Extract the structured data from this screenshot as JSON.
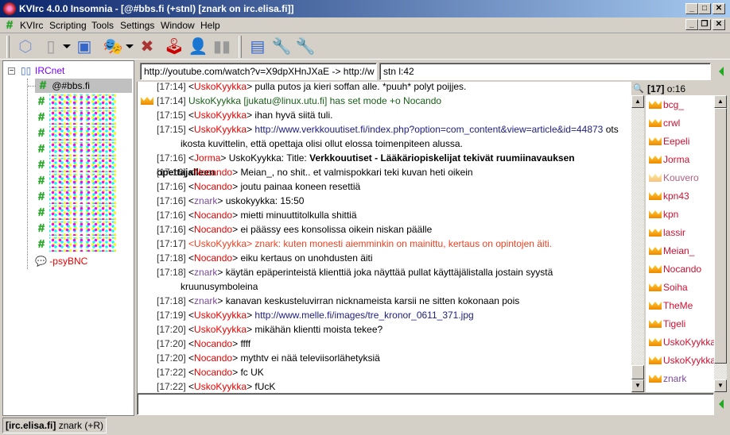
{
  "window": {
    "title": "KVIrc 4.0.0 Insomnia - [@#bbs.fi (+stnl) [znark on irc.elisa.fi]]",
    "min": "_",
    "max": "□",
    "restore": "❐",
    "close": "✕"
  },
  "menu": [
    "KVIrc",
    "Scripting",
    "Tools",
    "Settings",
    "Window",
    "Help"
  ],
  "tree": {
    "network": "IRCnet",
    "active_channel": "@#bbs.fi",
    "query": "-psyBNC"
  },
  "topic": "http://youtube.com/watch?v=X9dpXHnJXaE -> http://w",
  "modes": "stn l:42",
  "messages": [
    {
      "time": "[17:14]",
      "nick": "UskoKyykka",
      "text": "pulla putos ja kieri soffan alle. *puuh* polyt poijjes.",
      "type": "msg"
    },
    {
      "time": "[17:14]",
      "nick": "",
      "text": "UskoKyykka [jukatu@linux.utu.fi] has set mode +o Nocando",
      "type": "mode"
    },
    {
      "time": "[17:15]",
      "nick": "UskoKyykka",
      "text": "ihan hyvä siitä tuli.",
      "type": "msg"
    },
    {
      "time": "[17:15]",
      "nick": "UskoKyykka",
      "text": "http://www.verkkouutiset.fi/index.php?option=com_content&view=article&id=44873",
      "text2": " ots",
      "cont": "ikosta kuvittelin, että opettaja olisi ollut elossa toimenpiteen alussa.",
      "type": "url"
    },
    {
      "time": "[17:16]",
      "nick": "Jorma",
      "text": "UskoKyykka: Title: ",
      "bold": "Verkkouutiset - Lääkäriopiskelijat tekivät ruumiinavauksen opettajalleen",
      "type": "title"
    },
    {
      "time": "[17:16]",
      "nick": "Nocando",
      "text": "Meian_, no shit.. et valmispokkari teki kuvan heti oikein",
      "type": "msg"
    },
    {
      "time": "[17:16]",
      "nick": "Nocando",
      "text": "joutu painaa koneen resettiä",
      "type": "msg"
    },
    {
      "time": "[17:16]",
      "nick": "znark",
      "text": "uskokyykka: 15:50",
      "type": "self"
    },
    {
      "time": "[17:16]",
      "nick": "Nocando",
      "text": "mietti minuuttitolkulla shittiä",
      "type": "msg"
    },
    {
      "time": "[17:16]",
      "nick": "Nocando",
      "text": "ei päässy ees konsolissa oikein niskan päälle",
      "type": "msg"
    },
    {
      "time": "[17:17]",
      "nick": "UskoKyykka",
      "text": "znark: kuten monesti aiemminkin on mainittu, kertaus on opintojen äiti.",
      "type": "highlight"
    },
    {
      "time": "[17:18]",
      "nick": "Nocando",
      "text": "eiku kertaus on unohdusten äiti",
      "type": "msg"
    },
    {
      "time": "[17:18]",
      "nick": "znark",
      "text": "käytän epäperinteistä klienttiä joka näyttää pullat käyttäjälistalla jostain syystä",
      "cont": "kruunusymboleina",
      "type": "self"
    },
    {
      "time": "[17:18]",
      "nick": "znark",
      "text": "kanavan keskusteluvirran nicknameista karsii ne sitten kokonaan pois",
      "type": "self"
    },
    {
      "time": "[17:19]",
      "nick": "UskoKyykka",
      "text": "http://www.melle.fi/images/tre_kronor_0611_371.jpg",
      "type": "url"
    },
    {
      "time": "[17:20]",
      "nick": "UskoKyykka",
      "text": "mikähän klientti moista tekee?",
      "type": "msg"
    },
    {
      "time": "[17:20]",
      "nick": "Nocando",
      "text": "ffff",
      "type": "msg"
    },
    {
      "time": "[17:20]",
      "nick": "Nocando",
      "text": "mythtv ei nää televiisorlähetyksiä",
      "type": "msg"
    },
    {
      "time": "[17:22]",
      "nick": "Nocando",
      "text": "fc UK",
      "type": "msg"
    },
    {
      "time": "[17:22]",
      "nick": "UskoKyykka",
      "text": "fUcK",
      "type": "msg"
    }
  ],
  "userlist": {
    "count": "[17]",
    "ops": "o:16",
    "users": [
      "bcg_",
      "crwl",
      "Eepeli",
      "Jorma",
      "Kouvero",
      "kpn43",
      "kpn",
      "lassir",
      "Meian_",
      "Nocando",
      "Soiha",
      "TheMe",
      "Tigeli",
      "UskoKyykka",
      "UskoKyykka",
      "znark"
    ]
  },
  "input": "",
  "statusbar": {
    "server": "[irc.elisa.fi]",
    "nick": "znark (+R)"
  }
}
